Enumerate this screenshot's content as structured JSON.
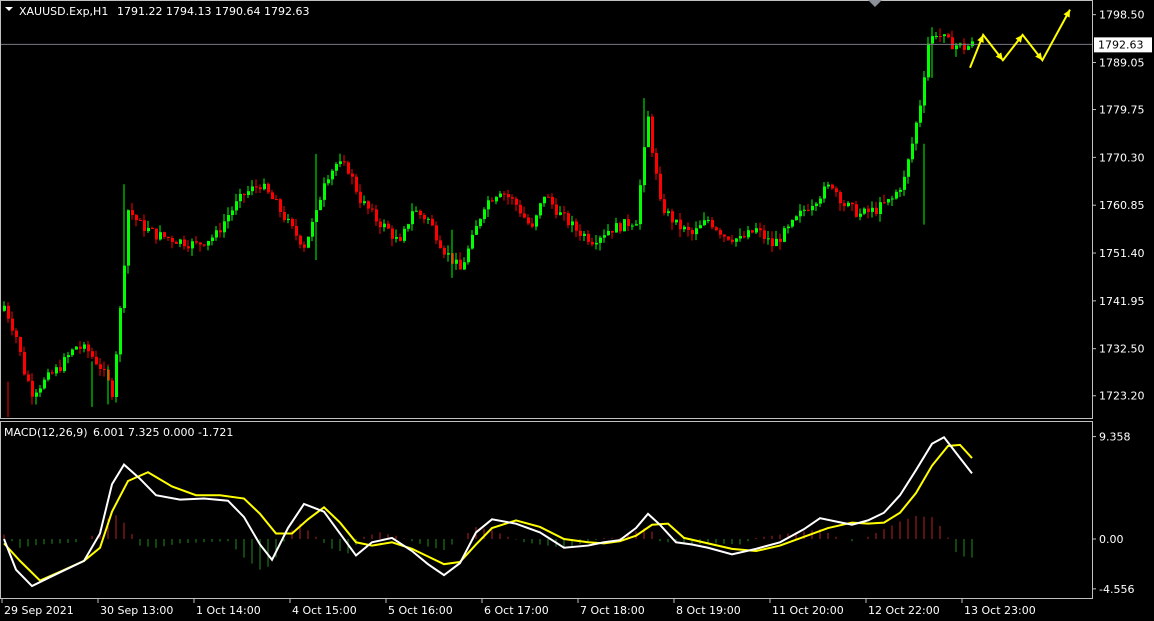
{
  "colors": {
    "background": "#000000",
    "frame": "#c0c0c0",
    "bull": "#00ff00",
    "bear": "#ff0000",
    "price_line": "#7a7a86",
    "price_tag_bg": "#ffffff",
    "price_tag_fg": "#000000",
    "macd_line": "#ffffff",
    "signal_line": "#ffff00",
    "hist_pos": "#b22222",
    "hist_neg": "#228b22",
    "forecast": "#ffff00"
  },
  "header": {
    "symbol_tf": "XAUUSD.Exp,H1",
    "ohlc": "1791.22 1794.13 1790.64 1792.63"
  },
  "macd_header": {
    "name": "MACD(12,26,9)",
    "values": "6.001 7.325 0.000 -1.721"
  },
  "current_price_label": "1792.63",
  "chart_data": [
    {
      "type": "candlestick",
      "title": "XAUUSD.Exp,H1",
      "symbol": "XAUUSD.Exp",
      "timeframe": "H1",
      "ohlc_last": {
        "open": 1791.22,
        "high": 1794.13,
        "low": 1790.64,
        "close": 1792.63
      },
      "ylim": [
        1719.0,
        1801.0
      ],
      "y_ticks": [
        "1798.50",
        "1789.05",
        "1779.75",
        "1770.30",
        "1760.85",
        "1751.40",
        "1741.95",
        "1732.50",
        "1723.20"
      ],
      "y_tick_values": [
        1798.5,
        1789.05,
        1779.75,
        1770.3,
        1760.85,
        1751.4,
        1741.95,
        1732.5,
        1723.2
      ],
      "current_price": 1792.63,
      "close_path": [
        [
          0,
          1741
        ],
        [
          3,
          1735
        ],
        [
          5,
          1728
        ],
        [
          7,
          1724
        ],
        [
          10,
          1726
        ],
        [
          14,
          1729
        ],
        [
          18,
          1733
        ],
        [
          21,
          1732
        ],
        [
          24,
          1729
        ],
        [
          27,
          1724
        ],
        [
          29,
          1740
        ],
        [
          31,
          1760
        ],
        [
          34,
          1757
        ],
        [
          38,
          1755
        ],
        [
          43,
          1754
        ],
        [
          48,
          1753
        ],
        [
          53,
          1755
        ],
        [
          56,
          1759
        ],
        [
          60,
          1763
        ],
        [
          64,
          1765
        ],
        [
          68,
          1761
        ],
        [
          72,
          1756
        ],
        [
          75,
          1753
        ],
        [
          78,
          1759
        ],
        [
          80,
          1766
        ],
        [
          83,
          1769
        ],
        [
          86,
          1768
        ],
        [
          89,
          1762
        ],
        [
          93,
          1758
        ],
        [
          96,
          1756
        ],
        [
          99,
          1753
        ],
        [
          102,
          1760
        ],
        [
          106,
          1758
        ],
        [
          110,
          1752
        ],
        [
          114,
          1748
        ],
        [
          117,
          1754
        ],
        [
          120,
          1761
        ],
        [
          124,
          1764
        ],
        [
          128,
          1761
        ],
        [
          132,
          1756
        ],
        [
          135,
          1763
        ],
        [
          139,
          1759
        ],
        [
          143,
          1756
        ],
        [
          147,
          1754
        ],
        [
          151,
          1756
        ],
        [
          155,
          1757
        ],
        [
          158,
          1758
        ],
        [
          161,
          1778
        ],
        [
          162,
          1772
        ],
        [
          164,
          1761
        ],
        [
          168,
          1757
        ],
        [
          172,
          1755
        ],
        [
          176,
          1758
        ],
        [
          180,
          1755
        ],
        [
          184,
          1754
        ],
        [
          188,
          1756
        ],
        [
          192,
          1753
        ],
        [
          196,
          1756
        ],
        [
          200,
          1760
        ],
        [
          204,
          1763
        ],
        [
          207,
          1765
        ],
        [
          210,
          1761
        ],
        [
          214,
          1759
        ],
        [
          218,
          1760
        ],
        [
          222,
          1762
        ],
        [
          225,
          1766
        ],
        [
          227,
          1773
        ],
        [
          229,
          1781
        ],
        [
          231,
          1793
        ],
        [
          233,
          1795
        ],
        [
          236,
          1793
        ],
        [
          240,
          1792
        ],
        [
          242,
          1792.63
        ]
      ],
      "spikes": [
        [
          1,
          1719.0,
          1726.0
        ],
        [
          22,
          1721.0,
          1730.0
        ],
        [
          26,
          1721.5,
          1729.0
        ],
        [
          30,
          1743.0,
          1765.0
        ],
        [
          78,
          1750.0,
          1771.0
        ],
        [
          112,
          1746.5,
          1756.0
        ],
        [
          160,
          1765.0,
          1782.0
        ],
        [
          230,
          1757.0,
          1773.0
        ],
        [
          232,
          1786.0,
          1796.0
        ]
      ],
      "forecast_path": [
        [
          1796,
          1788.0
        ],
        [
          1806,
          1794.5
        ],
        [
          1821,
          1789.5
        ],
        [
          1836,
          1794.5
        ],
        [
          1851,
          1789.5
        ],
        [
          1872,
          1799.5
        ]
      ],
      "x_ticks": [
        "29 Sep 2021",
        "30 Sep 13:00",
        "1 Oct 14:00",
        "4 Oct 15:00",
        "5 Oct 16:00",
        "6 Oct 17:00",
        "7 Oct 18:00",
        "8 Oct 19:00",
        "11 Oct 20:00",
        "12 Oct 22:00",
        "13 Oct 23:00"
      ],
      "x_tick_bars": [
        0,
        24,
        48,
        72,
        96,
        120,
        144,
        168,
        192,
        216,
        240
      ],
      "grid": false
    },
    {
      "type": "line",
      "title": "MACD(12,26,9)",
      "values_last": [
        6.001,
        7.325,
        0.0,
        -1.721
      ],
      "ylim": [
        -5.3,
        10.6
      ],
      "y_ticks": [
        "9.358",
        "0.00",
        "-4.556"
      ],
      "y_tick_values": [
        9.358,
        0.0,
        -4.556
      ],
      "series": [
        {
          "name": "MACD",
          "color": "#ffffff",
          "points": [
            [
              0,
              0.0
            ],
            [
              3,
              -2.8
            ],
            [
              7,
              -4.3
            ],
            [
              12,
              -3.4
            ],
            [
              20,
              -2.0
            ],
            [
              24,
              0.5
            ],
            [
              27,
              5.0
            ],
            [
              30,
              6.8
            ],
            [
              34,
              5.5
            ],
            [
              38,
              4.0
            ],
            [
              44,
              3.6
            ],
            [
              50,
              3.7
            ],
            [
              56,
              3.5
            ],
            [
              60,
              2.0
            ],
            [
              64,
              -0.5
            ],
            [
              67,
              -1.9
            ],
            [
              71,
              1.0
            ],
            [
              75,
              3.2
            ],
            [
              80,
              2.5
            ],
            [
              84,
              0.5
            ],
            [
              88,
              -1.5
            ],
            [
              92,
              -0.3
            ],
            [
              97,
              0.1
            ],
            [
              102,
              -1.1
            ],
            [
              106,
              -2.3
            ],
            [
              110,
              -3.3
            ],
            [
              114,
              -2.2
            ],
            [
              118,
              0.6
            ],
            [
              122,
              1.8
            ],
            [
              128,
              1.4
            ],
            [
              134,
              0.6
            ],
            [
              140,
              -0.8
            ],
            [
              146,
              -0.6
            ],
            [
              150,
              -0.3
            ],
            [
              154,
              -0.1
            ],
            [
              158,
              1.0
            ],
            [
              161,
              2.3
            ],
            [
              164,
              1.3
            ],
            [
              168,
              -0.3
            ],
            [
              172,
              -0.5
            ],
            [
              176,
              -0.8
            ],
            [
              182,
              -1.4
            ],
            [
              188,
              -0.9
            ],
            [
              194,
              -0.3
            ],
            [
              200,
              0.9
            ],
            [
              204,
              1.9
            ],
            [
              208,
              1.6
            ],
            [
              212,
              1.3
            ],
            [
              216,
              1.7
            ],
            [
              220,
              2.4
            ],
            [
              224,
              4.0
            ],
            [
              228,
              6.3
            ],
            [
              232,
              8.7
            ],
            [
              235,
              9.3
            ],
            [
              239,
              7.4
            ],
            [
              242,
              6.0
            ]
          ]
        },
        {
          "name": "Signal",
          "color": "#ffff00",
          "points": [
            [
              0,
              -0.4
            ],
            [
              4,
              -2.0
            ],
            [
              9,
              -3.8
            ],
            [
              14,
              -3.0
            ],
            [
              20,
              -2.0
            ],
            [
              24,
              -0.8
            ],
            [
              27,
              2.5
            ],
            [
              31,
              5.3
            ],
            [
              36,
              6.1
            ],
            [
              42,
              4.8
            ],
            [
              48,
              4.0
            ],
            [
              54,
              4.0
            ],
            [
              60,
              3.7
            ],
            [
              64,
              2.3
            ],
            [
              68,
              0.5
            ],
            [
              72,
              0.5
            ],
            [
              76,
              1.8
            ],
            [
              80,
              2.9
            ],
            [
              84,
              1.5
            ],
            [
              88,
              -0.3
            ],
            [
              92,
              -0.6
            ],
            [
              97,
              -0.3
            ],
            [
              102,
              -0.9
            ],
            [
              106,
              -1.6
            ],
            [
              110,
              -2.3
            ],
            [
              114,
              -2.1
            ],
            [
              118,
              -0.5
            ],
            [
              122,
              1.0
            ],
            [
              128,
              1.7
            ],
            [
              134,
              1.1
            ],
            [
              140,
              0.0
            ],
            [
              146,
              -0.3
            ],
            [
              150,
              -0.4
            ],
            [
              154,
              -0.2
            ],
            [
              158,
              0.3
            ],
            [
              162,
              1.3
            ],
            [
              166,
              1.4
            ],
            [
              170,
              0.1
            ],
            [
              176,
              -0.4
            ],
            [
              182,
              -0.9
            ],
            [
              188,
              -1.1
            ],
            [
              194,
              -0.6
            ],
            [
              200,
              0.2
            ],
            [
              206,
              1.0
            ],
            [
              212,
              1.5
            ],
            [
              216,
              1.4
            ],
            [
              220,
              1.5
            ],
            [
              224,
              2.4
            ],
            [
              228,
              4.2
            ],
            [
              232,
              6.7
            ],
            [
              236,
              8.5
            ],
            [
              239,
              8.6
            ],
            [
              242,
              7.4
            ]
          ]
        },
        {
          "name": "Histogram",
          "type": "bar",
          "points": [
            [
              0,
              0.4
            ],
            [
              4,
              -0.8
            ],
            [
              9,
              -0.5
            ],
            [
              14,
              -0.4
            ],
            [
              18,
              -0.3
            ],
            [
              22,
              0.3
            ],
            [
              25,
              1.2
            ],
            [
              27,
              2.5
            ],
            [
              30,
              1.5
            ],
            [
              34,
              -0.6
            ],
            [
              38,
              -0.8
            ],
            [
              44,
              -0.4
            ],
            [
              50,
              -0.3
            ],
            [
              56,
              -0.2
            ],
            [
              60,
              -1.7
            ],
            [
              64,
              -2.8
            ],
            [
              67,
              -2.4
            ],
            [
              71,
              0.5
            ],
            [
              74,
              1.4
            ],
            [
              78,
              0.2
            ],
            [
              82,
              -0.9
            ],
            [
              86,
              -1.3
            ],
            [
              90,
              0.2
            ],
            [
              94,
              0.6
            ],
            [
              98,
              0.3
            ],
            [
              102,
              -0.2
            ],
            [
              106,
              -0.7
            ],
            [
              110,
              -1.0
            ],
            [
              114,
              0.0
            ],
            [
              118,
              1.1
            ],
            [
              122,
              0.8
            ],
            [
              126,
              0.2
            ],
            [
              130,
              -0.3
            ],
            [
              134,
              -0.5
            ],
            [
              140,
              -0.8
            ],
            [
              146,
              -0.3
            ],
            [
              150,
              0.1
            ],
            [
              154,
              0.1
            ],
            [
              158,
              0.7
            ],
            [
              161,
              1.1
            ],
            [
              164,
              -0.2
            ],
            [
              168,
              -0.4
            ],
            [
              172,
              -0.5
            ],
            [
              178,
              -0.4
            ],
            [
              184,
              -0.5
            ],
            [
              188,
              0.1
            ],
            [
              194,
              0.4
            ],
            [
              200,
              0.7
            ],
            [
              204,
              0.9
            ],
            [
              208,
              0.2
            ],
            [
              212,
              -0.2
            ],
            [
              216,
              0.2
            ],
            [
              220,
              0.9
            ],
            [
              224,
              1.6
            ],
            [
              228,
              2.1
            ],
            [
              232,
              2.0
            ],
            [
              235,
              0.8
            ],
            [
              238,
              -1.2
            ],
            [
              240,
              -1.6
            ],
            [
              242,
              -1.7
            ]
          ]
        }
      ],
      "grid": false
    }
  ]
}
